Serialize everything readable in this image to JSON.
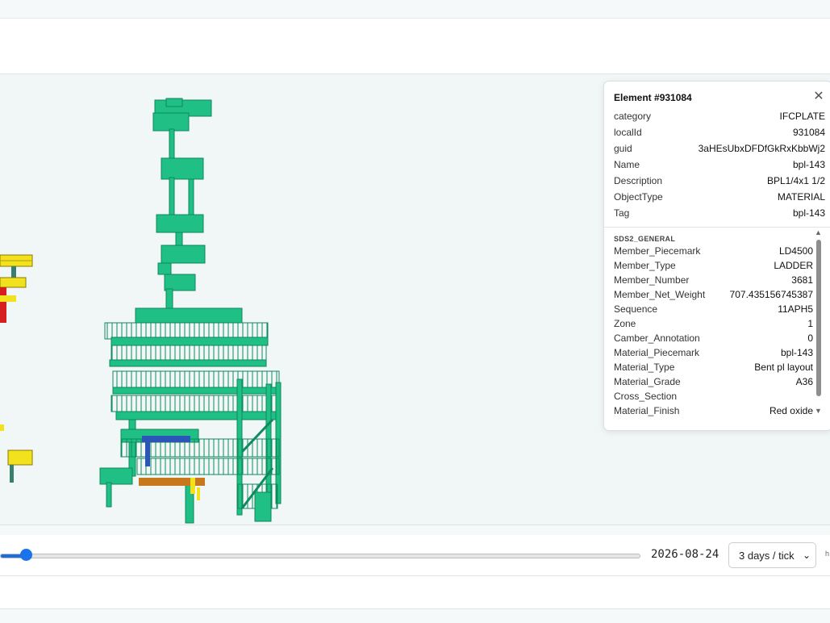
{
  "viewer": {
    "playback_date": "2026-08-24",
    "speed_select": {
      "selected": "3 days / tick"
    },
    "timeline_progress": 0.04,
    "tail_label": "h"
  },
  "element_panel": {
    "title": "Element #931084",
    "attributes": [
      {
        "key": "category",
        "value": "IFCPLATE"
      },
      {
        "key": "localId",
        "value": "931084"
      },
      {
        "key": "guid",
        "value": "3aHEsUbxDFDfGkRxKbbWj2"
      },
      {
        "key": "Name",
        "value": "bpl-143"
      },
      {
        "key": "Description",
        "value": "BPL1/4x1 1/2"
      },
      {
        "key": "ObjectType",
        "value": "MATERIAL"
      },
      {
        "key": "Tag",
        "value": "bpl-143"
      }
    ],
    "section_title": "SDS2_GENERAL",
    "properties": [
      {
        "key": "Member_Piecemark",
        "value": "LD4500"
      },
      {
        "key": "Member_Type",
        "value": "LADDER"
      },
      {
        "key": "Member_Number",
        "value": "3681"
      },
      {
        "key": "Member_Net_Weight",
        "value": "707.435156745387"
      },
      {
        "key": "Sequence",
        "value": "11APH5"
      },
      {
        "key": "Zone",
        "value": "1"
      },
      {
        "key": "Camber_Annotation",
        "value": "0"
      },
      {
        "key": "Material_Piecemark",
        "value": "bpl-143"
      },
      {
        "key": "Material_Type",
        "value": "Bent pl layout"
      },
      {
        "key": "Material_Grade",
        "value": "A36"
      },
      {
        "key": "Cross_Section",
        "value": ""
      },
      {
        "key": "Material_Finish",
        "value": "Red oxide"
      }
    ]
  },
  "colors": {
    "structure_green": "#1fbf86",
    "structure_dark": "#0e8a5c",
    "highlight_yellow": "#f2e21d",
    "member_orange": "#c8781c",
    "member_blue": "#2c55b8",
    "slider_blue": "#1a73e8"
  },
  "icons": {
    "close": "close-icon",
    "scroll_up": "scroll-up-icon",
    "scroll_down": "scroll-down-icon"
  }
}
